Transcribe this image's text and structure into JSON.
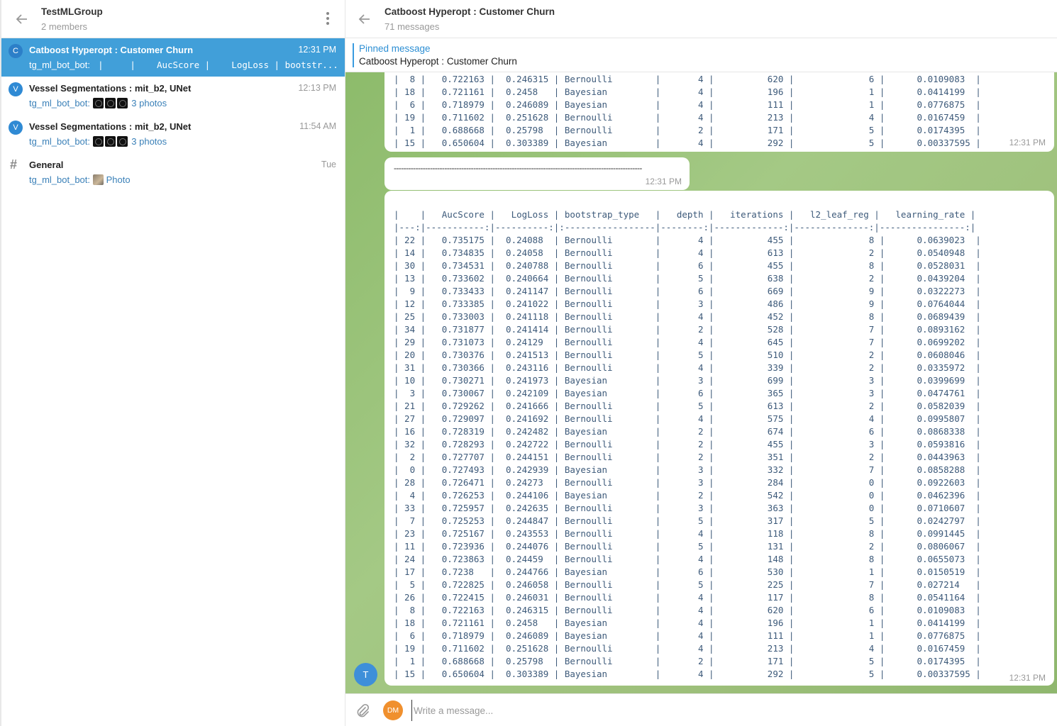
{
  "left": {
    "group_title": "TestMLGroup",
    "members": "2 members",
    "chats": [
      {
        "avatar": "C",
        "name": "Catboost Hyperopt : Customer Churn",
        "time": "12:31 PM",
        "sender": "tg_ml_bot_bot:",
        "preview": " |     |    AucScore |    LogLoss | bootstr..."
      },
      {
        "avatar": "V",
        "name": "Vessel Segmentations : mit_b2, UNet",
        "time": "12:13 PM",
        "sender": "tg_ml_bot_bot:",
        "preview": "3 photos"
      },
      {
        "avatar": "V",
        "name": "Vessel Segmentations : mit_b2, UNet",
        "time": "11:54 AM",
        "sender": "tg_ml_bot_bot:",
        "preview": "3 photos"
      },
      {
        "avatar": "#",
        "name": "General",
        "time": "Tue",
        "sender": "tg_ml_bot_bot:",
        "preview": "Photo"
      }
    ]
  },
  "right": {
    "title": "Catboost Hyperopt : Customer Churn",
    "count": "71 messages",
    "pinned_title": "Pinned message",
    "pinned_text": "Catboost Hyperopt : Customer Churn"
  },
  "messages": {
    "top_rows": [
      "|  8 |   0.722163 |  0.246315 | Bernoulli        |       4 |          620 |              6 |      0.0109083  |",
      "| 18 |   0.721161 |  0.2458   | Bayesian         |       4 |          196 |              1 |      0.0414199  |",
      "|  6 |   0.718979 |  0.246089 | Bayesian         |       4 |          111 |              1 |      0.0776875  |",
      "| 19 |   0.711602 |  0.251628 | Bernoulli        |       4 |          213 |              4 |      0.0167459  |",
      "|  1 |   0.688668 |  0.25798  | Bernoulli        |       2 |          171 |              5 |      0.0174395  |",
      "| 15 |   0.650604 |  0.303389 | Bayesian         |       4 |          292 |              5 |      0.00337595 |"
    ],
    "top_time": "12:31 PM",
    "separator": "-------------------------------------------------------------------------------------------------------",
    "separator_time": "12:31 PM",
    "table_rows": [
      "|    |   AucScore |   LogLoss | bootstrap_type   |   depth |   iterations |   l2_leaf_reg |   learning_rate |",
      "|---:|-----------:|----------:|:-----------------|--------:|-------------:|--------------:|----------------:|",
      "| 22 |   0.735175 |  0.24088  | Bernoulli        |       4 |          455 |              8 |      0.0639023  |",
      "| 14 |   0.734835 |  0.24058  | Bernoulli        |       4 |          613 |              2 |      0.0540948  |",
      "| 30 |   0.734531 |  0.240788 | Bernoulli        |       6 |          455 |              8 |      0.0528031  |",
      "| 13 |   0.733602 |  0.240664 | Bernoulli        |       5 |          638 |              2 |      0.0439204  |",
      "|  9 |   0.733433 |  0.241147 | Bernoulli        |       6 |          669 |              9 |      0.0322273  |",
      "| 12 |   0.733385 |  0.241022 | Bernoulli        |       3 |          486 |              9 |      0.0764044  |",
      "| 25 |   0.733003 |  0.241118 | Bernoulli        |       4 |          452 |              8 |      0.0689439  |",
      "| 34 |   0.731877 |  0.241414 | Bernoulli        |       2 |          528 |              7 |      0.0893162  |",
      "| 29 |   0.731073 |  0.24129  | Bernoulli        |       4 |          645 |              7 |      0.0699202  |",
      "| 20 |   0.730376 |  0.241513 | Bernoulli        |       5 |          510 |              2 |      0.0608046  |",
      "| 31 |   0.730366 |  0.243116 | Bernoulli        |       4 |          339 |              2 |      0.0335972  |",
      "| 10 |   0.730271 |  0.241973 | Bayesian         |       3 |          699 |              3 |      0.0399699  |",
      "|  3 |   0.730067 |  0.242109 | Bayesian         |       6 |          365 |              3 |      0.0474761  |",
      "| 21 |   0.729262 |  0.241666 | Bernoulli        |       5 |          613 |              2 |      0.0582039  |",
      "| 27 |   0.729097 |  0.241692 | Bernoulli        |       4 |          575 |              4 |      0.0995807  |",
      "| 16 |   0.728319 |  0.242482 | Bayesian         |       2 |          674 |              6 |      0.0868338  |",
      "| 32 |   0.728293 |  0.242722 | Bernoulli        |       2 |          455 |              3 |      0.0593816  |",
      "|  2 |   0.727707 |  0.244151 | Bernoulli        |       2 |          351 |              2 |      0.0443963  |",
      "|  0 |   0.727493 |  0.242939 | Bayesian         |       3 |          332 |              7 |      0.0858288  |",
      "| 28 |   0.726471 |  0.24273  | Bernoulli        |       3 |          284 |              0 |      0.0922603  |",
      "|  4 |   0.726253 |  0.244106 | Bayesian         |       2 |          542 |              0 |      0.0462396  |",
      "| 33 |   0.725957 |  0.242635 | Bernoulli        |       3 |          363 |              0 |      0.0710607  |",
      "|  7 |   0.725253 |  0.244847 | Bernoulli        |       5 |          317 |              5 |      0.0242797  |",
      "| 23 |   0.725167 |  0.243553 | Bernoulli        |       4 |          118 |              8 |      0.0991445  |",
      "| 11 |   0.723936 |  0.244076 | Bernoulli        |       5 |          131 |              2 |      0.0806067  |",
      "| 24 |   0.723863 |  0.24459  | Bernoulli        |       4 |          148 |              8 |      0.0655073  |",
      "| 17 |   0.7238   |  0.244766 | Bayesian         |       6 |          530 |              1 |      0.0150519  |",
      "|  5 |   0.722825 |  0.246058 | Bernoulli        |       5 |          225 |              7 |      0.027214   |",
      "| 26 |   0.722415 |  0.246031 | Bernoulli        |       4 |          117 |              8 |      0.0541164  |",
      "|  8 |   0.722163 |  0.246315 | Bernoulli        |       4 |          620 |              6 |      0.0109083  |",
      "| 18 |   0.721161 |  0.2458   | Bayesian         |       4 |          196 |              1 |      0.0414199  |",
      "|  6 |   0.718979 |  0.246089 | Bayesian         |       4 |          111 |              1 |      0.0776875  |",
      "| 19 |   0.711602 |  0.251628 | Bernoulli        |       4 |          213 |              4 |      0.0167459  |",
      "|  1 |   0.688668 |  0.25798  | Bernoulli        |       2 |          171 |              5 |      0.0174395  |",
      "| 15 |   0.650604 |  0.303389 | Bayesian         |       4 |          292 |              5 |      0.00337595 |"
    ],
    "table_time": "12:31 PM",
    "sender_avatar": "T"
  },
  "composer": {
    "avatar": "DM",
    "placeholder": "Write a message..."
  },
  "colors": {
    "accent": "#419fd9",
    "link": "#3a80b8",
    "chat_bg": "#9cc47c",
    "mono_text": "#3d5a7a"
  },
  "icons": {
    "back": "arrow-left-icon",
    "menu": "kebab-menu-icon",
    "attach": "paperclip-icon"
  }
}
